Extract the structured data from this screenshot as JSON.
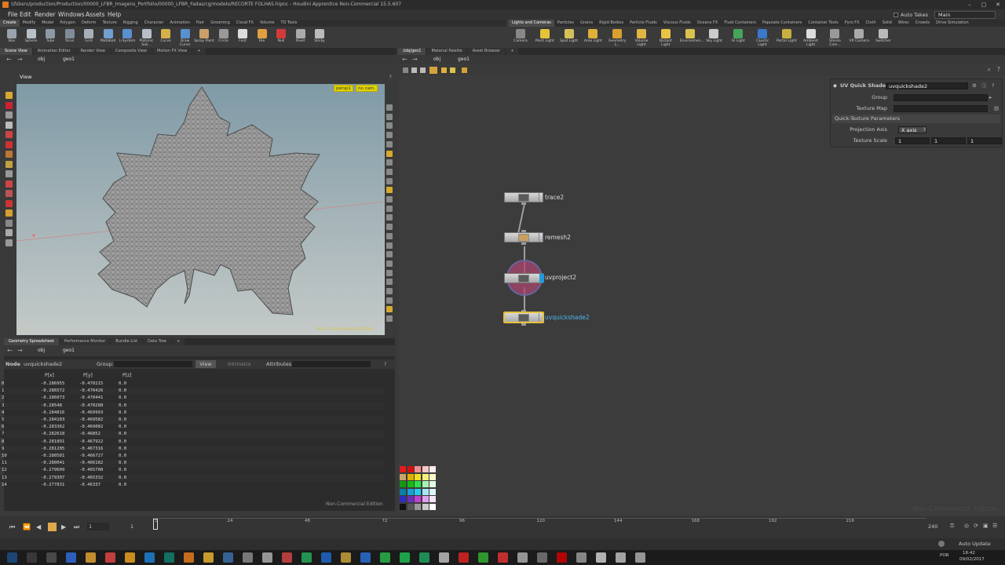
{
  "window": {
    "title": "\\\\fsbsrv/production/Production/00000_LFBR_Imagens_Portfolio/00000_LFBR_Fadas/cg/modelo/RECORTE FOLHAS.hipnc - Houdini Apprentice Non-Commercial 15.5.607"
  },
  "menu": [
    "File",
    "Edit",
    "Render",
    "Windows",
    "Assets",
    "Help"
  ],
  "topright": {
    "auto_takes": "Auto Takes",
    "desktop": "Main"
  },
  "shelf_left": {
    "tabs": [
      "Create",
      "Modify",
      "Model",
      "Polygon",
      "Deform",
      "Texture",
      "Rigging",
      "Character",
      "Animation",
      "Hair",
      "Grooming",
      "Cloud FX",
      "Volume",
      "TD Tools"
    ],
    "tools": [
      "Box",
      "Sphere",
      "Tube",
      "Torus",
      "Grid",
      "Metaball",
      "L-System",
      "Platonic Soli...",
      "Curve",
      "Draw Curve",
      "Spray Paint",
      "Circle",
      "Font",
      "File",
      "Null",
      "Rivet",
      "Sticky"
    ]
  },
  "shelf_right": {
    "tabs": [
      "Lights and Cameras",
      "Particles",
      "Grains",
      "Rigid Bodies",
      "Particle Fluids",
      "Viscous Fluids",
      "Oceans FX",
      "Fluid Containers",
      "Populate Containers",
      "Container Tools",
      "Pyro FX",
      "Cloth",
      "Solid",
      "Wires",
      "Crowds",
      "Drive Simulation"
    ],
    "tools": [
      "Camera",
      "Point Light",
      "Spot Light",
      "Area Light",
      "Geometry L...",
      "Volume Light",
      "Distant Light",
      "Environmen...",
      "Sky Light",
      "GI Light",
      "Caustic Light",
      "Portal Light",
      "Ambient Light",
      "Stereo Cam...",
      "VR Camera",
      "Switcher"
    ]
  },
  "viewer": {
    "tabs": [
      "Scene View",
      "Animation Editor",
      "Render View",
      "Composite View",
      "Motion FX View"
    ],
    "path": [
      "obj",
      "geo1"
    ],
    "title": "View",
    "camera_labels": [
      "persp1",
      "no cam."
    ],
    "watermark": "Non-Commercial Edition"
  },
  "spreadsheet": {
    "tabs": [
      "Geometry Spreadsheet",
      "Performance Monitor",
      "Bundle List",
      "Data Tree"
    ],
    "path": [
      "obj",
      "geo1"
    ],
    "node_label": "Node",
    "node_value": "uvquickshade2",
    "group_label": "Group:",
    "view_label": "View",
    "intrinsics_label": "Intrinsics",
    "attributes_label": "Attributes:",
    "columns": [
      "P[x]",
      "P[y]",
      "P[z]"
    ],
    "rows": [
      [
        "0",
        "-0.286955",
        "-0.470215",
        "0.0"
      ],
      [
        "1",
        "-0.286572",
        "-0.470426",
        "0.0"
      ],
      [
        "2",
        "-0.286073",
        "-0.470441",
        "0.0"
      ],
      [
        "3",
        "-0.28548",
        "-0.470288",
        "0.0"
      ],
      [
        "4",
        "-0.284816",
        "-0.469993",
        "0.0"
      ],
      [
        "5",
        "-0.284103",
        "-0.469582",
        "0.0"
      ],
      [
        "6",
        "-0.283362",
        "-0.469082",
        "0.0"
      ],
      [
        "7",
        "-0.282618",
        "-0.46852",
        "0.0"
      ],
      [
        "8",
        "-0.281891",
        "-0.467922",
        "0.0"
      ],
      [
        "9",
        "-0.281205",
        "-0.467316",
        "0.0"
      ],
      [
        "10",
        "-0.280581",
        "-0.466727",
        "0.0"
      ],
      [
        "11",
        "-0.280041",
        "-0.466182",
        "0.0"
      ],
      [
        "12",
        "-0.279609",
        "-0.465708",
        "0.0"
      ],
      [
        "13",
        "-0.279307",
        "-0.465332",
        "0.0"
      ],
      [
        "14",
        "-0.277831",
        "-0.46337",
        "0.0"
      ]
    ],
    "watermark": "Non-Commercial Edition"
  },
  "network": {
    "tabs": [
      "/obj/geo1",
      "Material Palette",
      "Asset Browser"
    ],
    "path": [
      "obj",
      "geo1"
    ],
    "nodes": [
      "trace2",
      "remesh2",
      "uvproject2",
      "uvquickshade2"
    ],
    "watermark": "Non-Commercial Edition"
  },
  "params": {
    "type": "UV Quick Shade",
    "name": "uvquickshade2",
    "group_label": "Group",
    "texture_map_label": "Texture Map",
    "section": "Quick-Texture Parameters",
    "projection_label": "Projection Axis",
    "projection_value": "X axis",
    "scale_label": "Texture Scale",
    "scale": [
      "1",
      "1",
      "1"
    ]
  },
  "timeline": {
    "frame": "1",
    "start": "1",
    "end": "240",
    "ticks": [
      "1",
      "24",
      "48",
      "72",
      "96",
      "120",
      "144",
      "168",
      "192",
      "216"
    ],
    "auto_update": "Auto Update"
  },
  "taskbar": {
    "lang": "POR",
    "time": "18:42",
    "date": "09/02/2017"
  }
}
